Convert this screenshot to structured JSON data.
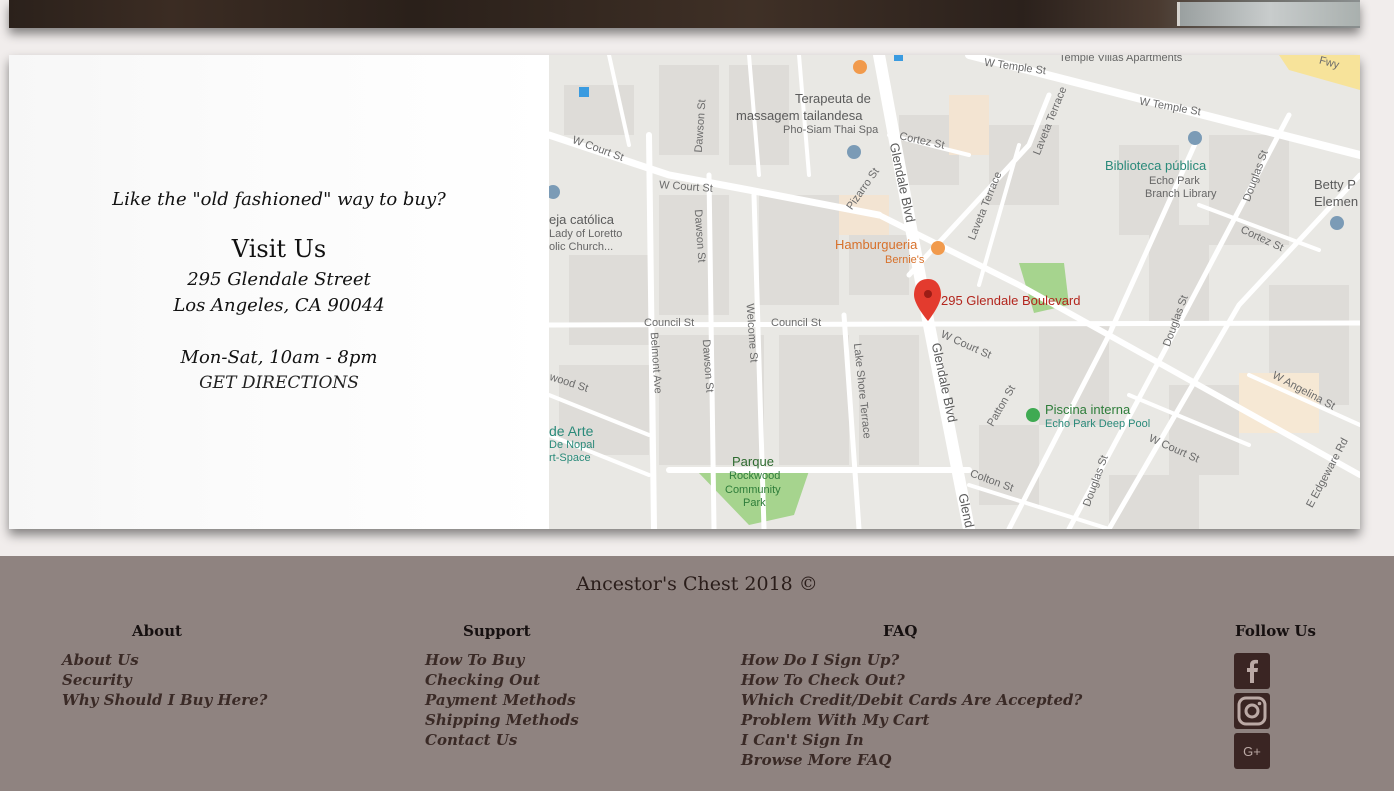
{
  "contact": {
    "tagline": "Like the \"old fashioned\" way to buy?",
    "title": "Visit Us",
    "street": "295 Glendale Street",
    "city": "Los Angeles, CA 90044",
    "hours": "Mon-Sat, 10am - 8pm",
    "directions_label": "GET DIRECTIONS"
  },
  "map": {
    "pin_label": "295 Glendale Boulevard",
    "places": {
      "temple_villas": "Temple Villas Apartments",
      "terapeuta": "Terapeuta de",
      "massagem": "massagem tailandesa",
      "pho_siam": "Pho-Siam Thai Spa",
      "biblioteca": "Biblioteca pública",
      "echo_park": "Echo Park",
      "branch_library": "Branch Library",
      "betty": "Betty P",
      "elemen": "Elemen",
      "iglesia": "eja católica",
      "lady": "Lady of Loretto",
      "church": "olic Church...",
      "hamburgueria": "Hamburgueria",
      "bernies": "Bernie's",
      "piscina": "Piscina interna",
      "deep_pool": "Echo Park Deep Pool",
      "de_arte": "de Arte",
      "de_nopal": "De Nopal",
      "art_space": "rt-Space",
      "parque": "Parque",
      "rockwood": "Rockwood",
      "community": "Community",
      "park": "Park"
    },
    "streets": {
      "w_temple_top": "W Temple St",
      "w_temple": "W Temple St",
      "fwy": "Fwy",
      "cortez_top": "Cortez St",
      "cortez_right": "Cortez St",
      "laveta": "Laveta Terrace",
      "laveta2": "Laveta Terrace",
      "w_court_left": "W Court St",
      "w_court_mid": "W Court St",
      "w_court_right": "W Court St",
      "w_court_br": "W Court St",
      "dawson_top": "Dawson St",
      "dawson_mid": "Dawson St",
      "dawson_low": "Dawson St",
      "douglas_top": "Douglas St",
      "douglas_mid": "Douglas St",
      "douglas_low": "Douglas St",
      "glendale_top": "Glendale Blvd",
      "glendale_mid": "Glendale Blvd",
      "glendale_bot": "Glend",
      "pizarro": "Pizarro St",
      "council_left": "Council St",
      "council_mid": "Council St",
      "welcome": "Welcome St",
      "belmont": "Belmont Ave",
      "lake_shore": "Lake Shore Terrace",
      "patton": "Patton St",
      "colton": "Colton St",
      "w_angelina": "W Angelina St",
      "e_edgeware": "E Edgeware Rd",
      "wood": "wood St"
    }
  },
  "footer": {
    "copyright": "Ancestor's Chest 2018 ©",
    "about": {
      "heading": "About",
      "links": [
        "About Us",
        "Security",
        "Why Should I Buy Here?"
      ]
    },
    "support": {
      "heading": "Support",
      "links": [
        "How To Buy",
        "Checking Out",
        "Payment Methods",
        "Shipping Methods",
        "Contact Us"
      ]
    },
    "faq": {
      "heading": "FAQ",
      "links": [
        "How Do I Sign Up?",
        "How To Check Out?",
        "Which Credit/Debit Cards Are Accepted?",
        "Problem With My Cart",
        "I Can't Sign In",
        "Browse More FAQ"
      ]
    },
    "follow": {
      "heading": "Follow Us",
      "icons": [
        "facebook-icon",
        "instagram-icon",
        "google-plus-icon"
      ],
      "gplus_text": "G+"
    }
  },
  "colors": {
    "footer_bg": "#8f8380",
    "page_bg": "#f1edec",
    "social_bg": "#3a2523",
    "pin": "#e33b2e"
  }
}
